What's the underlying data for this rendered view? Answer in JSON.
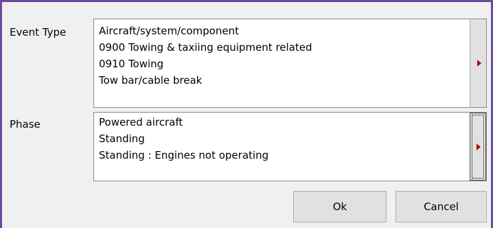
{
  "event_type": {
    "label": "Event Type",
    "items": [
      "Aircraft/system/component",
      "0900 Towing & taxiing equipment related",
      "0910 Towing",
      "Tow bar/cable break"
    ],
    "button_icon": "right-arrow-icon"
  },
  "phase": {
    "label": "Phase",
    "items": [
      "Powered aircraft",
      "Standing",
      "Standing : Engines not operating"
    ],
    "button_icon": "right-arrow-icon"
  },
  "buttons": {
    "ok": "Ok",
    "cancel": "Cancel"
  },
  "colors": {
    "window_border": "#6b4a9b",
    "arrow": "#a01010"
  }
}
